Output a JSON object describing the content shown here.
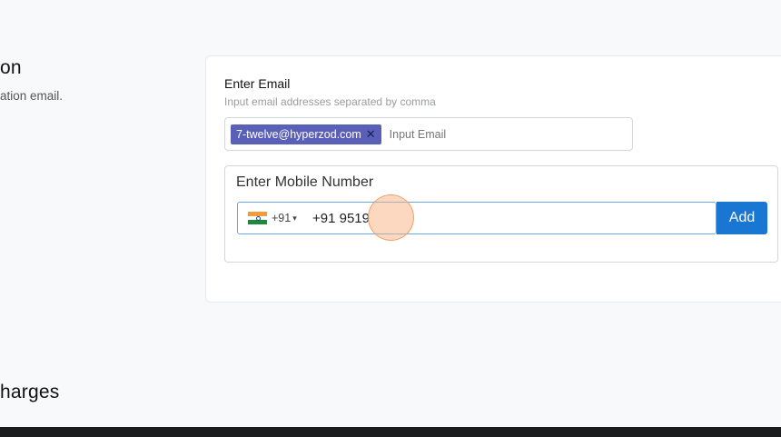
{
  "left_section": {
    "title_fragment": "on",
    "subtitle_fragment": "ation email."
  },
  "bottom_section": {
    "title_fragment": "harges"
  },
  "email": {
    "label": "Enter Email",
    "help": "Input email addresses separated by comma",
    "chips": [
      {
        "label": "7-twelve@hyperzod.com",
        "remove_icon": "✕"
      }
    ],
    "placeholder": "Input Email"
  },
  "mobile": {
    "label": "Enter Mobile Number",
    "country_flag": "india-flag-icon",
    "dial_code": "+91",
    "caret_icon": "▾",
    "value": "+91 9519",
    "add_label": "Add"
  },
  "colors": {
    "chip_bg": "#5a5fb8",
    "add_button": "#1976d2",
    "phone_focus_border": "#6aa5e6"
  }
}
